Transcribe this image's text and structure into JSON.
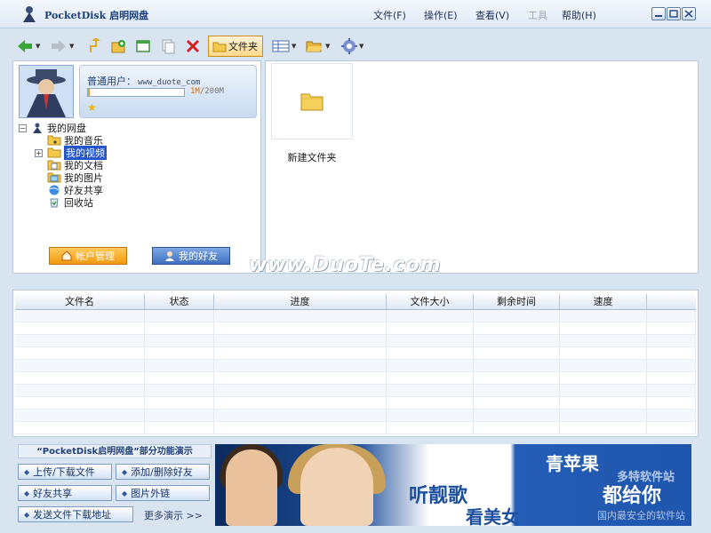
{
  "app": {
    "title": "PocketDisk 启明网盘",
    "menus": [
      {
        "label": "文件(F)"
      },
      {
        "label": "操作(E)"
      },
      {
        "label": "查看(V)"
      },
      {
        "label": "工具"
      },
      {
        "label": "帮助(H)"
      }
    ]
  },
  "toolbar": {
    "folder_label": "文件夹"
  },
  "user": {
    "label": "普通用户：",
    "name": "www_duote_com",
    "quota_used": "1M",
    "quota_total": "/200M",
    "quota_fraction": 0.005
  },
  "tree": {
    "root": "我的网盘",
    "items": [
      {
        "label": "我的音乐"
      },
      {
        "label": "我的视频"
      },
      {
        "label": "我的文档"
      },
      {
        "label": "我的图片"
      },
      {
        "label": "好友共享"
      },
      {
        "label": "回收站"
      }
    ]
  },
  "buttons": {
    "account": "帐户管理",
    "friends": "我的好友"
  },
  "files": {
    "new_folder": "新建文件夹"
  },
  "watermark": "www.DuoTe.com",
  "transfer": {
    "columns": [
      "文件名",
      "状态",
      "进度",
      "文件大小",
      "剩余时间",
      "速度",
      ""
    ]
  },
  "demo": {
    "title": "“PocketDisk启明网盘”部分功能演示",
    "buttons": [
      "上传/下载文件",
      "添加/删除好友",
      "好友共享",
      "图片外链",
      "发送文件下载地址"
    ],
    "more": "更多演示 >>"
  },
  "banner": {
    "slogan1": "听靓歌",
    "slogan2": "看美女",
    "slogan3": "青苹果",
    "slogan4": "都给你",
    "brand": "多特软件站",
    "brand_slogan": "国内最安全的软件站"
  },
  "colors": {
    "accent": "#2255cc",
    "orange": "#f09a0e"
  }
}
